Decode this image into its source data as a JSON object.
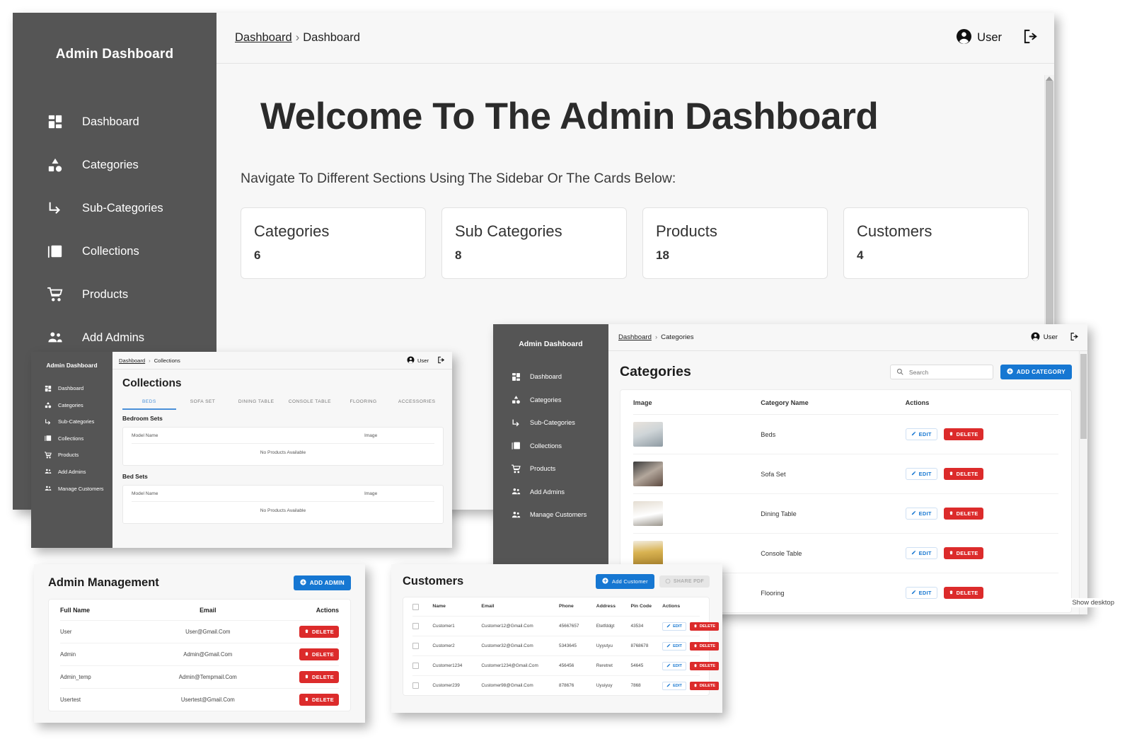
{
  "sidebar": {
    "title": "Admin Dashboard",
    "items": [
      {
        "label": "Dashboard",
        "icon": "dashboard-grid-icon"
      },
      {
        "label": "Categories",
        "icon": "shapes-icon"
      },
      {
        "label": "Sub-Categories",
        "icon": "arrow-branch-icon"
      },
      {
        "label": "Collections",
        "icon": "image-stack-icon"
      },
      {
        "label": "Products",
        "icon": "cart-icon"
      },
      {
        "label": "Add Admins",
        "icon": "people-icon"
      },
      {
        "label": "Manage Customers",
        "icon": "people-icon"
      }
    ]
  },
  "dashboard_window": {
    "breadcrumb": {
      "root": "Dashboard",
      "separator": "›",
      "current": "Dashboard"
    },
    "user": {
      "name": "User",
      "avatar_icon": "account-circle-icon",
      "logout_icon": "logout-icon"
    },
    "heading": "Welcome To The Admin Dashboard",
    "subheading": "Navigate To Different Sections Using The Sidebar Or The Cards Below:",
    "cards": [
      {
        "title": "Categories",
        "count": "6"
      },
      {
        "title": "Sub Categories",
        "count": "8"
      },
      {
        "title": "Products",
        "count": "18"
      },
      {
        "title": "Customers",
        "count": "4"
      }
    ]
  },
  "collections_window": {
    "breadcrumb": {
      "root": "Dashboard",
      "separator": "›",
      "current": "Collections"
    },
    "user": {
      "name": "User"
    },
    "title": "Collections",
    "tabs": [
      {
        "label": "BEDS",
        "active": true
      },
      {
        "label": "SOFA SET",
        "active": false
      },
      {
        "label": "DINING TABLE",
        "active": false
      },
      {
        "label": "CONSOLE TABLE",
        "active": false
      },
      {
        "label": "FLOORING",
        "active": false
      },
      {
        "label": "ACCESSORIES",
        "active": false
      }
    ],
    "sections": [
      {
        "title": "Bedroom Sets",
        "columns": {
          "model": "Model Name",
          "image": "Image"
        },
        "empty_text": "No Products Available"
      },
      {
        "title": "Bed Sets",
        "columns": {
          "model": "Model Name",
          "image": "Image"
        },
        "empty_text": "No Products Available"
      }
    ]
  },
  "categories_window": {
    "breadcrumb": {
      "root": "Dashboard",
      "separator": "›",
      "current": "Categories"
    },
    "user": {
      "name": "User"
    },
    "title": "Categories",
    "search": {
      "placeholder": "Search",
      "value": "",
      "icon": "search-icon"
    },
    "add_button": {
      "label": "ADD CATEGORY",
      "icon": "plus-circle-icon"
    },
    "columns": {
      "image": "Image",
      "name": "Category Name",
      "actions": "Actions"
    },
    "edit_label": "EDIT",
    "delete_label": "DELETE",
    "rows": [
      {
        "name": "Beds",
        "thumb": "#b9c0c6"
      },
      {
        "name": "Sofa Set",
        "thumb": "#6d5a52"
      },
      {
        "name": "Dining Table",
        "thumb": "#cfc6b6"
      },
      {
        "name": "Console Table",
        "thumb": "#cbab5c"
      },
      {
        "name": "Flooring",
        "thumb": "#d6cfc4"
      }
    ]
  },
  "admin_window": {
    "title": "Admin Management",
    "add_button": {
      "label": "ADD ADMIN",
      "icon": "plus-circle-icon"
    },
    "columns": {
      "name": "Full Name",
      "email": "Email",
      "actions": "Actions"
    },
    "delete_label": "DELETE",
    "rows": [
      {
        "name": "User",
        "email": "User@Gmail.Com"
      },
      {
        "name": "Admin",
        "email": "Admin@Gmail.Com"
      },
      {
        "name": "Admin_temp",
        "email": "Admin@Tempmail.Com"
      },
      {
        "name": "Usertest",
        "email": "Usertest@Gmail.Com"
      }
    ]
  },
  "customers_window": {
    "title": "Customers",
    "add_button": {
      "label": "Add Customer",
      "icon": "plus-circle-icon"
    },
    "share_button": {
      "label": "SHARE PDF",
      "icon": "share-icon"
    },
    "columns": {
      "check": "",
      "name": "Name",
      "email": "Email",
      "phone": "Phone",
      "address": "Address",
      "pin": "Pin Code",
      "actions": "Actions"
    },
    "edit_label": "EDIT",
    "delete_label": "DELETE",
    "rows": [
      {
        "name": "Customer1",
        "email": "Customer12@Gmail.Com",
        "phone": "45667657",
        "address": "Etetfddgt",
        "pin": "43534"
      },
      {
        "name": "Customer2",
        "email": "Customer32@Gmail.Com",
        "phone": "5343645",
        "address": "Uyyutyu",
        "pin": "8768678"
      },
      {
        "name": "Customer1234",
        "email": "Customer1234@Gmail.Com",
        "phone": "456456",
        "address": "Reretret",
        "pin": "54645"
      },
      {
        "name": "Customer239",
        "email": "Customer98@Gmail.Com",
        "phone": "878676",
        "address": "Uyuiyuy",
        "pin": "7868"
      }
    ]
  },
  "desktop": {
    "show_desktop_tooltip": "Show desktop"
  },
  "colors": {
    "sidebar": "#555555",
    "accent_blue": "#1677d2",
    "danger_red": "#dc2b2b",
    "tab_active": "#4a90d9"
  }
}
